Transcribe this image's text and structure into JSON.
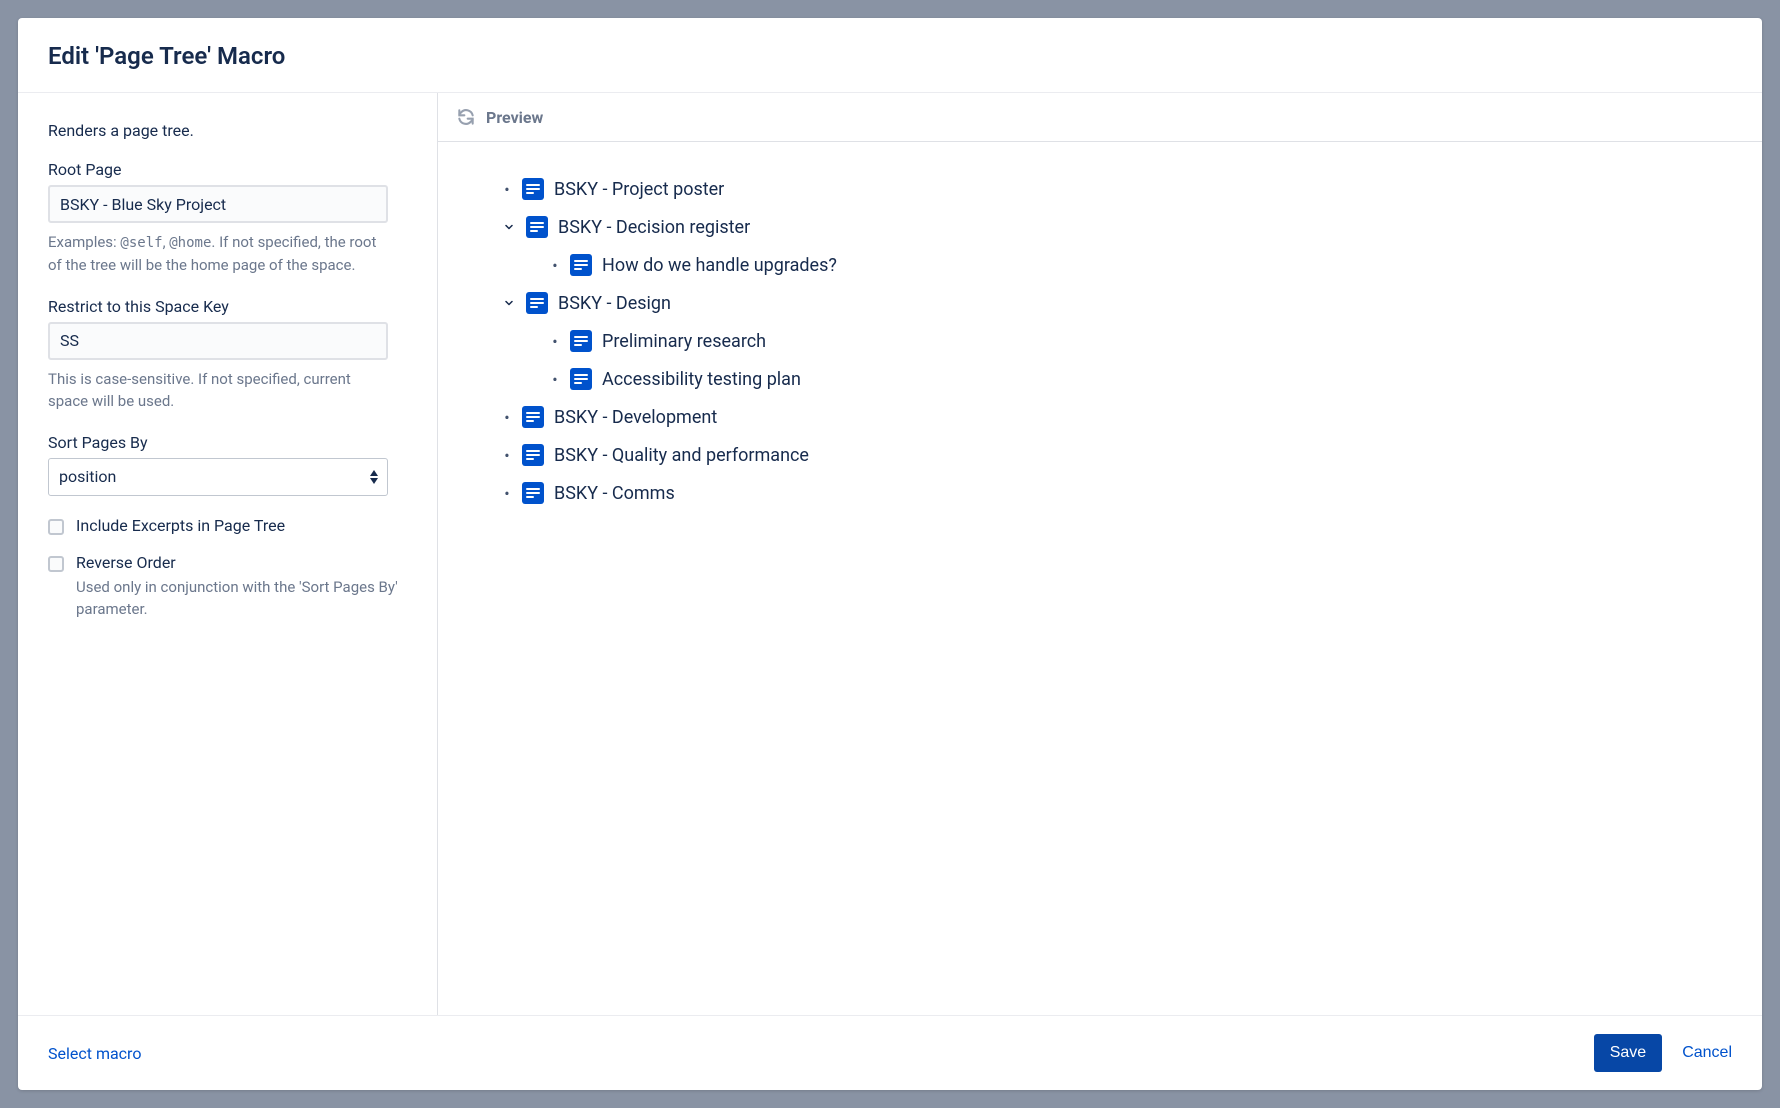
{
  "header": {
    "title": "Edit 'Page Tree' Macro"
  },
  "settings": {
    "description": "Renders a page tree.",
    "fields": {
      "rootPage": {
        "label": "Root Page",
        "value": "BSKY - Blue Sky Project",
        "help_prefix": "Examples: ",
        "help_mono1": "@self",
        "help_sep": ", ",
        "help_mono2": "@home",
        "help_suffix": ". If not specified, the root of the tree will be the home page of the space."
      },
      "spaceKey": {
        "label": "Restrict to this Space Key",
        "value": "SS",
        "help": "This is case-sensitive. If not specified, current space will be used."
      },
      "sortBy": {
        "label": "Sort Pages By",
        "value": "position"
      },
      "includeExcerpts": {
        "label": "Include Excerpts in Page Tree",
        "checked": false
      },
      "reverseOrder": {
        "label": "Reverse Order",
        "checked": false,
        "help": "Used only in conjunction with the 'Sort Pages By' parameter."
      }
    }
  },
  "preview": {
    "title": "Preview",
    "tree": [
      {
        "label": "BSKY - Project poster",
        "expandable": false,
        "children": []
      },
      {
        "label": "BSKY - Decision register",
        "expandable": true,
        "children": [
          {
            "label": "How do we handle upgrades?",
            "expandable": false,
            "children": []
          }
        ]
      },
      {
        "label": "BSKY - Design",
        "expandable": true,
        "children": [
          {
            "label": "Preliminary research",
            "expandable": false,
            "children": []
          },
          {
            "label": "Accessibility testing plan",
            "expandable": false,
            "children": []
          }
        ]
      },
      {
        "label": "BSKY - Development",
        "expandable": false,
        "children": []
      },
      {
        "label": "BSKY - Quality and performance",
        "expandable": false,
        "children": []
      },
      {
        "label": "BSKY - Comms",
        "expandable": false,
        "children": []
      }
    ]
  },
  "footer": {
    "selectMacro": "Select macro",
    "save": "Save",
    "cancel": "Cancel"
  }
}
